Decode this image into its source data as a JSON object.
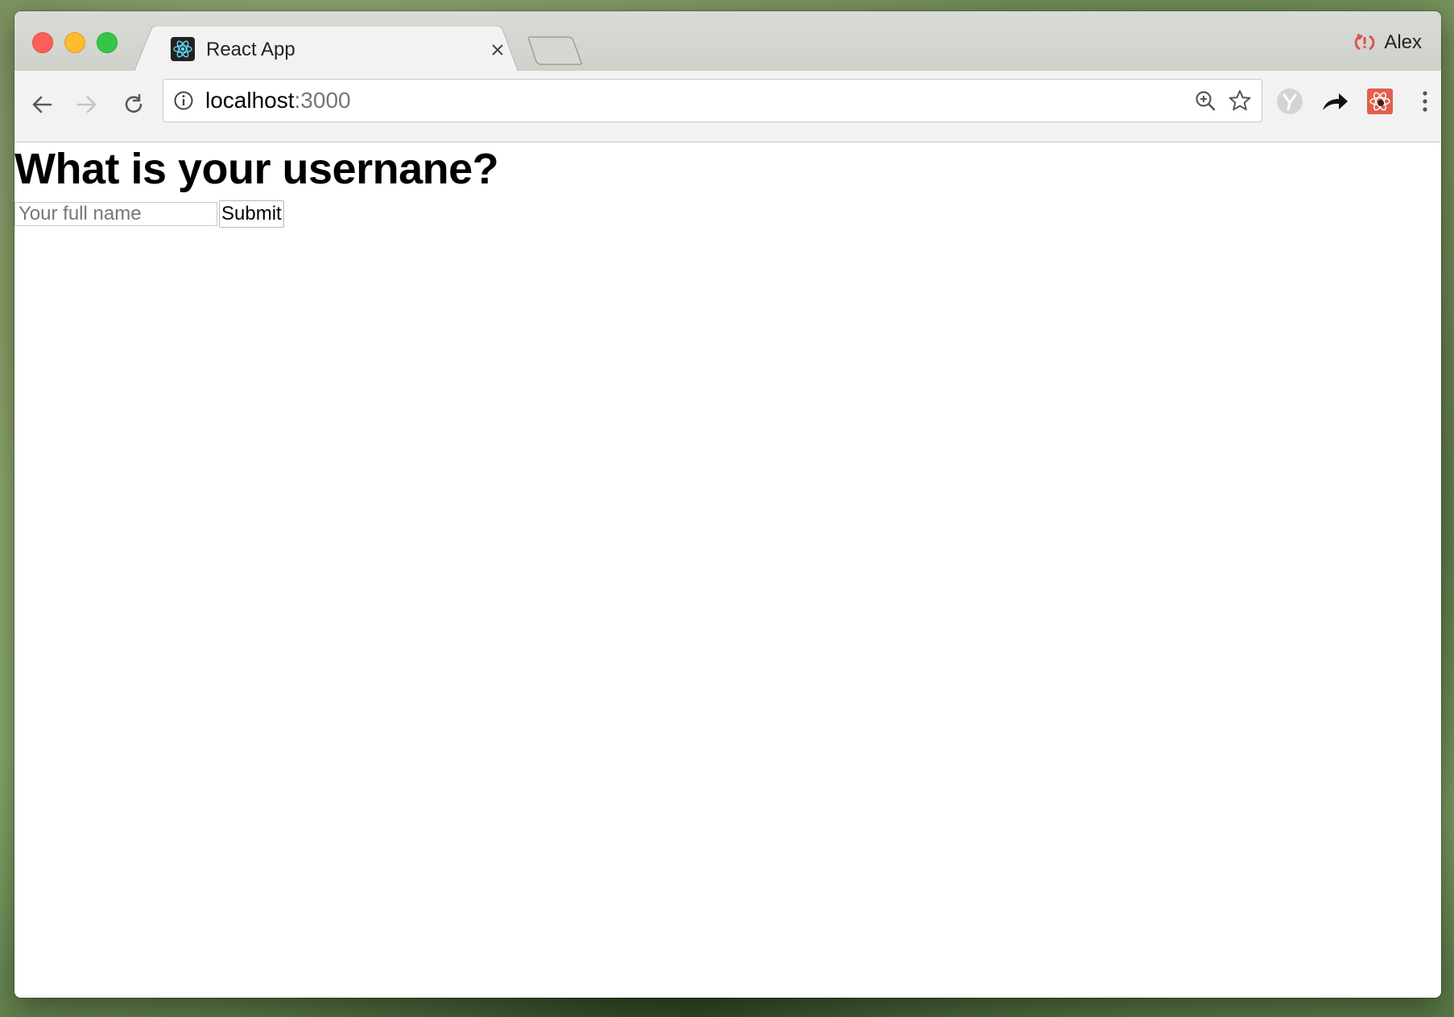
{
  "browser": {
    "tab": {
      "title": "React App",
      "favicon": "react-logo-icon"
    },
    "profile": {
      "name": "Alex",
      "icon": "sync-error-icon"
    },
    "address": {
      "host": "localhost",
      "port": ":3000"
    },
    "colors": {
      "profile_icon": "#d9534f",
      "extension_3_bg": "#e0604f"
    }
  },
  "page": {
    "heading": "What is your usernane?",
    "form": {
      "name_placeholder": "Your full name",
      "name_value": "",
      "submit_label": "Submit"
    }
  }
}
